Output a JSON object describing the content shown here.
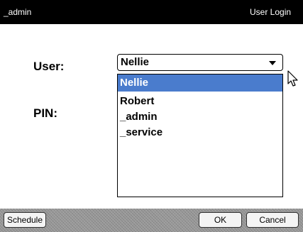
{
  "title_bar": {
    "left_text": "_admin",
    "right_text": "User Login"
  },
  "form": {
    "user_label": "User:",
    "pin_label": "PIN:",
    "user_select": {
      "selected_value": "Nellie",
      "options": [
        "Nellie",
        "Robert",
        "_admin",
        "_service"
      ],
      "highlighted_index": 0
    }
  },
  "toolbar": {
    "schedule_label": "Schedule",
    "ok_label": "OK",
    "cancel_label": "Cancel"
  },
  "colors": {
    "title_bar_bg": "#000000",
    "highlight": "#4a7ccd",
    "bottom_bar_bg": "#9a9a9a"
  },
  "icons": {
    "dropdown_arrow": "chevron-down-icon",
    "cursor": "mouse-pointer-icon"
  }
}
